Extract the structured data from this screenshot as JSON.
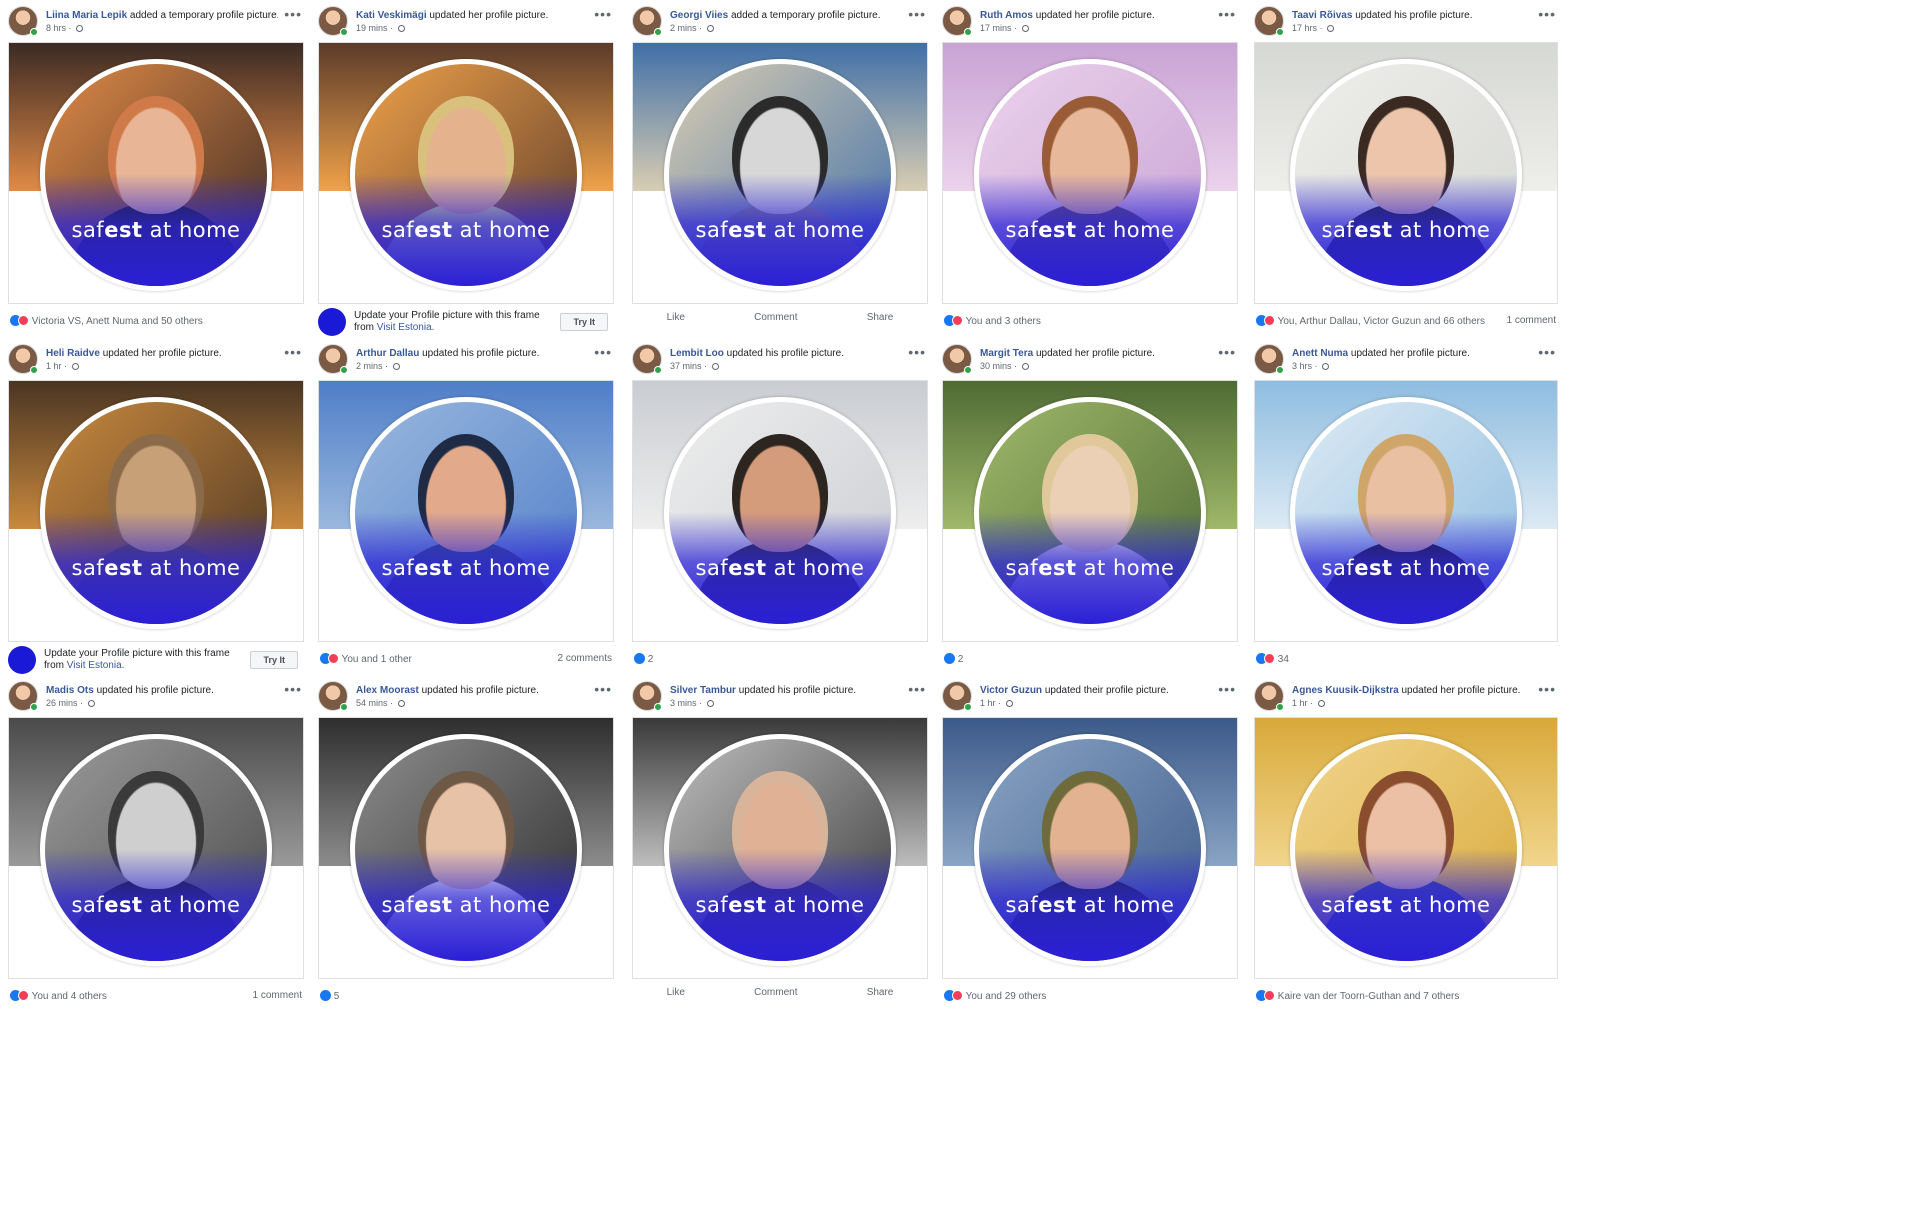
{
  "frame": {
    "text_pre": "saf",
    "text_bold": "est",
    "text_post": " at home"
  },
  "promo": {
    "text": "Update your Profile picture with this frame from ",
    "link": "Visit Estonia.",
    "button": "Try It"
  },
  "actions": {
    "like": "Like",
    "comment": "Comment",
    "share": "Share"
  },
  "posts": [
    {
      "author": "Liina Maria Lepik",
      "action": "added a temporary profile picture.",
      "time": "8 hrs",
      "footer_type": "reactions",
      "reactions": "Victoria VS, Anett Numa and 50 others",
      "comments": "",
      "banner": "#3b2a24",
      "banner2": "#e08a46",
      "skin": "#e8b596",
      "hair": "#d07a4a",
      "shirt": "#1d1d1f"
    },
    {
      "author": "Kati Veskimägi",
      "action": "updated her profile picture.",
      "time": "19 mins",
      "footer_type": "promo",
      "reactions": "",
      "comments": "",
      "banner": "#5b3b2a",
      "banner2": "#f0a24a",
      "skin": "#e4b38e",
      "hair": "#d9c07c",
      "shirt": "#d8dc8c"
    },
    {
      "author": "Georgi Viies",
      "action": "added a temporary profile picture.",
      "time": "2 mins",
      "footer_type": "actions",
      "reactions": "",
      "comments": "",
      "banner": "#3f6fa8",
      "banner2": "#d9cdb2",
      "skin": "#d7d7d7",
      "hair": "#2b2b2b",
      "shirt": "#8c8c8c"
    },
    {
      "author": "Ruth Amos",
      "action": "updated her profile picture.",
      "time": "17 mins",
      "footer_type": "reactions",
      "reactions": "You and 3 others",
      "comments": "",
      "banner": "#c8a3d4",
      "banner2": "#ecd2ec",
      "skin": "#e8b89a",
      "hair": "#9a5c36",
      "shirt": "#5e4a6a"
    },
    {
      "author": "Taavi Rõivas",
      "action": "updated his profile picture.",
      "time": "17 hrs",
      "footer_type": "reactions",
      "reactions": "You, Arthur Dallau, Victor Guzun and 66 others",
      "comments": "1 comment",
      "banner": "#d6d8d4",
      "banner2": "#eeeeea",
      "skin": "#edc5aa",
      "hair": "#3a2a22",
      "shirt": "#22252b"
    },
    {
      "author": "Heli Raidve",
      "action": "updated her profile picture.",
      "time": "1 hr",
      "footer_type": "promo",
      "reactions": "",
      "comments": "",
      "banner": "#4a3522",
      "banner2": "#c9893e",
      "skin": "#c8a078",
      "hair": "#8a6a48",
      "shirt": "#5b4b3b"
    },
    {
      "author": "Arthur Dallau",
      "action": "updated his profile picture.",
      "time": "2 mins",
      "footer_type": "reactions",
      "reactions": "You and 1 other",
      "comments": "2 comments",
      "banner": "#4f7ec8",
      "banner2": "#9ab8de",
      "skin": "#e2a98a",
      "hair": "#1f2a44",
      "shirt": "#34507a"
    },
    {
      "author": "Lembit Loo",
      "action": "updated his profile picture.",
      "time": "37 mins",
      "footer_type": "count",
      "reactions": "2",
      "comments": "",
      "banner": "#c9ccd1",
      "banner2": "#eeeeee",
      "skin": "#d59c7b",
      "hair": "#2d2520",
      "shirt": "#2b2b2b"
    },
    {
      "author": "Margit Tera",
      "action": "updated her profile picture.",
      "time": "30 mins",
      "footer_type": "count",
      "reactions": "2",
      "comments": "",
      "banner": "#4f6b34",
      "banner2": "#9fb86a",
      "skin": "#ecd0b6",
      "hair": "#e1c89a",
      "shirt": "#e8e4e0"
    },
    {
      "author": "Anett Numa",
      "action": "updated her profile picture.",
      "time": "3 hrs",
      "footer_type": "reactions",
      "reactions": "34",
      "comments": "",
      "banner": "#8fbde0",
      "banner2": "#dceaf4",
      "skin": "#e9c0a2",
      "hair": "#cfa56a",
      "shirt": "#1c1c20"
    },
    {
      "author": "Madis Ots",
      "action": "updated his profile picture.",
      "time": "26 mins",
      "footer_type": "reactions",
      "reactions": "You and 4 others",
      "comments": "1 comment",
      "banner": "#4a4a4a",
      "banner2": "#9a9a9a",
      "skin": "#cfcfcf",
      "hair": "#3a3a3a",
      "shirt": "#1f1f1f"
    },
    {
      "author": "Alex Moorast",
      "action": "updated his profile picture.",
      "time": "54 mins",
      "footer_type": "count",
      "reactions": "5",
      "comments": "",
      "banner": "#2e2e2e",
      "banner2": "#8c8c8c",
      "skin": "#e7c2a6",
      "hair": "#6e5846",
      "shirt": "#f2f2f2"
    },
    {
      "author": "Silver Tambur",
      "action": "updated his profile picture.",
      "time": "3 mins",
      "footer_type": "actions",
      "reactions": "",
      "comments": "",
      "banner": "#3a3a3a",
      "banner2": "#bdbdbd",
      "skin": "#e1b195",
      "hair": "#d8b49a",
      "shirt": "#3a2e5a"
    },
    {
      "author": "Victor Guzun",
      "action": "updated their profile picture.",
      "time": "1 hr",
      "footer_type": "reactions",
      "reactions": "You and 29 others",
      "comments": "",
      "banner": "#3c5a8a",
      "banner2": "#8aa4c4",
      "skin": "#e3b291",
      "hair": "#6e6a3a",
      "shirt": "#1f2740"
    },
    {
      "author": "Agnes Kuusik-Dijkstra",
      "action": "updated her profile picture.",
      "time": "1 hr",
      "footer_type": "reactions",
      "reactions": "Kaire van der Toorn-Guthan and 7 others",
      "comments": "",
      "banner": "#d8a93a",
      "banner2": "#f1d58c",
      "skin": "#ecc0a4",
      "hair": "#8a4e2e",
      "shirt": "#3d4aa0"
    }
  ]
}
